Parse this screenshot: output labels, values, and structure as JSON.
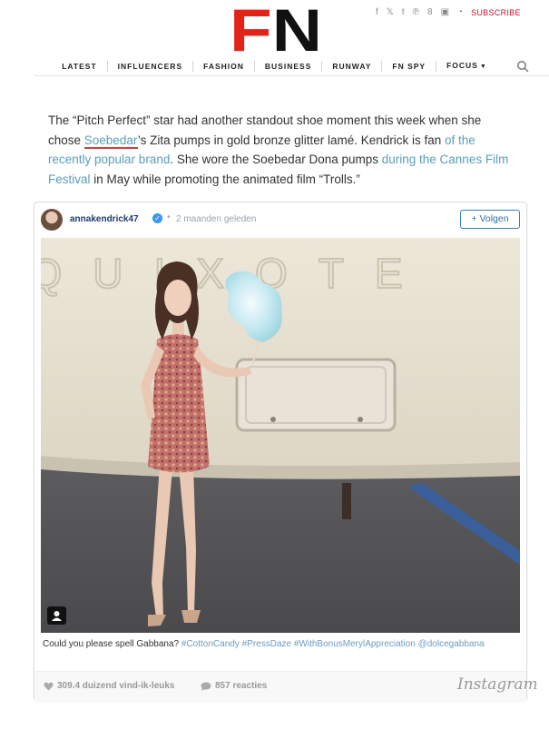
{
  "site": {
    "logo_text": "FN",
    "subscribe_label": "SUBSCRIBE",
    "social_icons": [
      "facebook-icon",
      "twitter-icon",
      "tumblr-icon",
      "pinterest-icon",
      "googleplus-icon",
      "instagram-icon",
      "rss-icon"
    ]
  },
  "nav": {
    "items": [
      "LATEST",
      "INFLUENCERS",
      "FASHION",
      "BUSINESS",
      "RUNWAY",
      "FN SPY",
      "FOCUS"
    ]
  },
  "article": {
    "p1": "The “Pitch Perfect” star had another standout shoe moment this week when she chose ",
    "link1": "Soebedar",
    "p2": "’s Zita pumps in gold bronze glitter lamé. Kendrick is fan ",
    "link2": "of the recently popular brand",
    "p3": ". She wore the Soebedar Dona pumps ",
    "link3": "during the Cannes Film Festival",
    "p4": " in May while promoting the animated film “Trolls.”"
  },
  "embed": {
    "username": "annakendrick47",
    "verified_mark": "✓",
    "separator": "•",
    "time": "2 maanden geleden",
    "follow_label": "+ Volgen",
    "photo_sign": "QUIXOTE",
    "caption_text": "Could you please spell Gabbana? ",
    "caption_tags": "#CottonCandy #PressDaze #WithBonusMerylAppreciation @dolcegabbana",
    "likes": "309.4 duizend vind-ik-leuks",
    "comments": "857 reacties",
    "brand": "Instagram"
  }
}
